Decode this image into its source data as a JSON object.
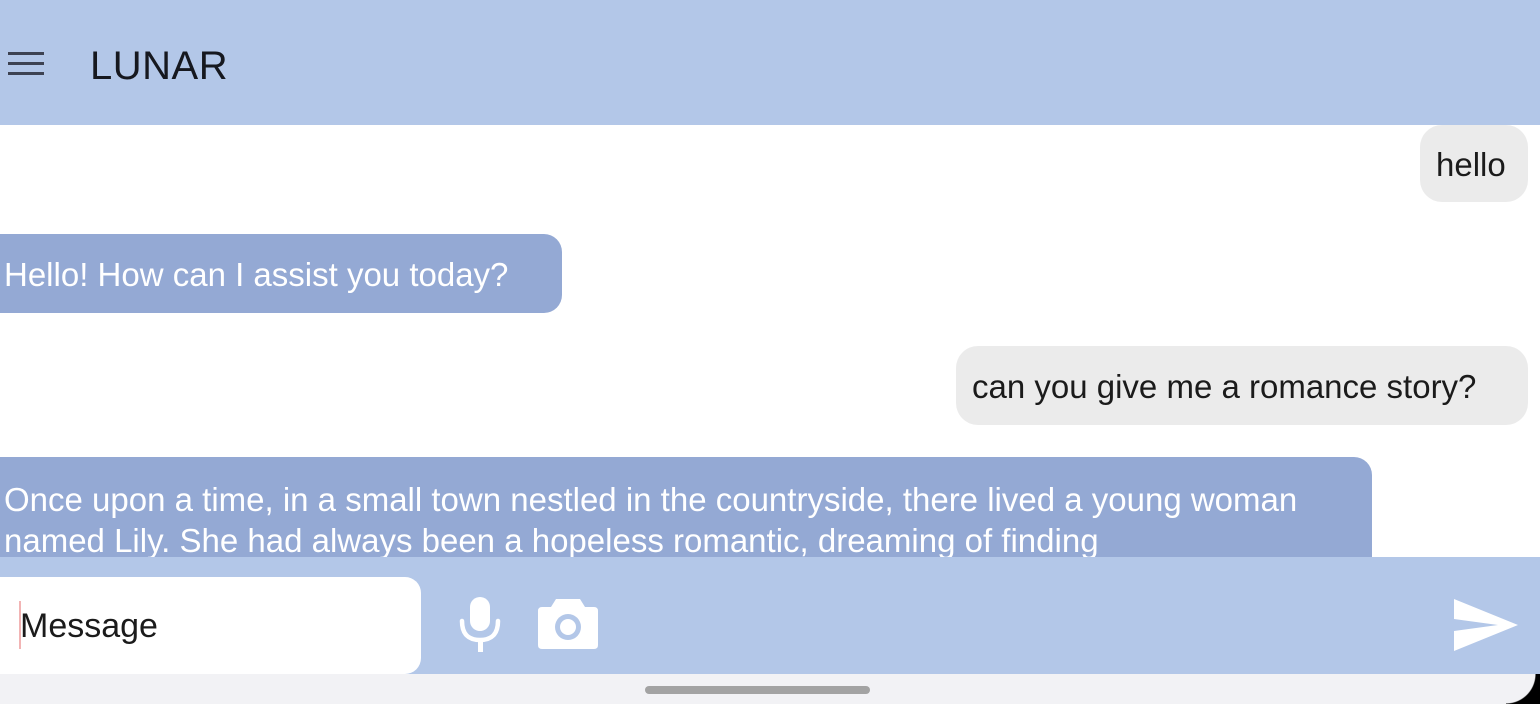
{
  "header": {
    "menu_icon": "hamburger-menu-icon",
    "title": "LUNAR"
  },
  "messages": [
    {
      "role": "user",
      "text": "hello"
    },
    {
      "role": "assistant",
      "text": "Hello! How can I assist you today?"
    },
    {
      "role": "user",
      "text": "can you give me a romance story?"
    },
    {
      "role": "assistant",
      "text": "Once upon a time, in a small town nestled in the countryside, there lived a young woman named Lily. She had always been a hopeless romantic, dreaming of finding"
    }
  ],
  "composer": {
    "placeholder": "Message",
    "mic_icon": "microphone-icon",
    "camera_icon": "camera-icon",
    "send_icon": "send-icon"
  },
  "colors": {
    "header_bg": "#b3c7e8",
    "assistant_bubble": "#94a9d4",
    "user_bubble": "#ebebeb"
  }
}
